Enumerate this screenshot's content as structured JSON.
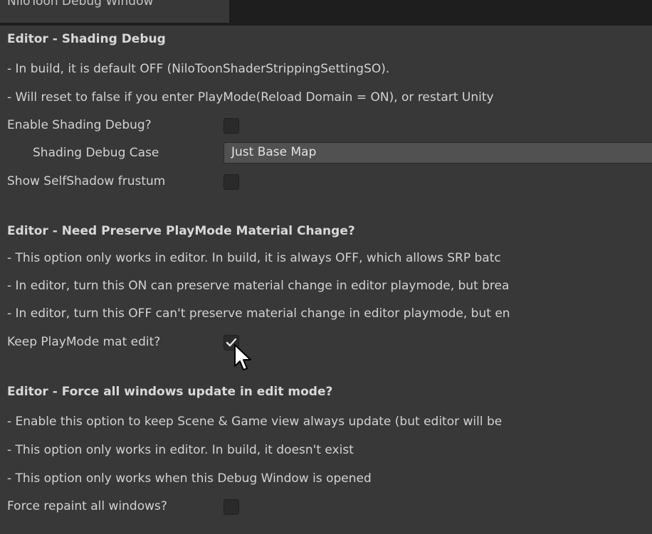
{
  "window": {
    "tab_title": "NiloToon Debug Window"
  },
  "shading_debug": {
    "header": "Editor - Shading Debug",
    "notes": [
      "- In build, it is default OFF (NiloToonShaderStrippingSettingSO).",
      "- Will reset to false if you enter PlayMode(Reload Domain = ON), or restart Unity"
    ],
    "enable_label": "Enable Shading Debug?",
    "enable_checked": false,
    "case_label": "Shading Debug Case",
    "case_value": "Just Base Map",
    "selfshadow_label": "Show SelfShadow frustum",
    "selfshadow_checked": false
  },
  "preserve_playmode": {
    "header": "Editor - Need Preserve PlayMode Material Change?",
    "notes": [
      "- This option only works in editor. In build, it is always OFF, which allows SRP batc",
      "- In editor, turn this ON  can preserve material change in editor playmode, but brea",
      "- In editor, turn this OFF can't preserve material change in editor playmode, but en"
    ],
    "keep_label": "Keep PlayMode mat edit?",
    "keep_checked": true
  },
  "force_update": {
    "header": "Editor - Force all windows update in edit mode?",
    "notes": [
      "- Enable this option to keep Scene & Game view always update (but editor will be",
      "- This option only works in editor. In build, it doesn't exist",
      "- This option only works when this Debug Window is opened"
    ],
    "repaint_label": "Force repaint all windows?",
    "repaint_checked": false
  }
}
